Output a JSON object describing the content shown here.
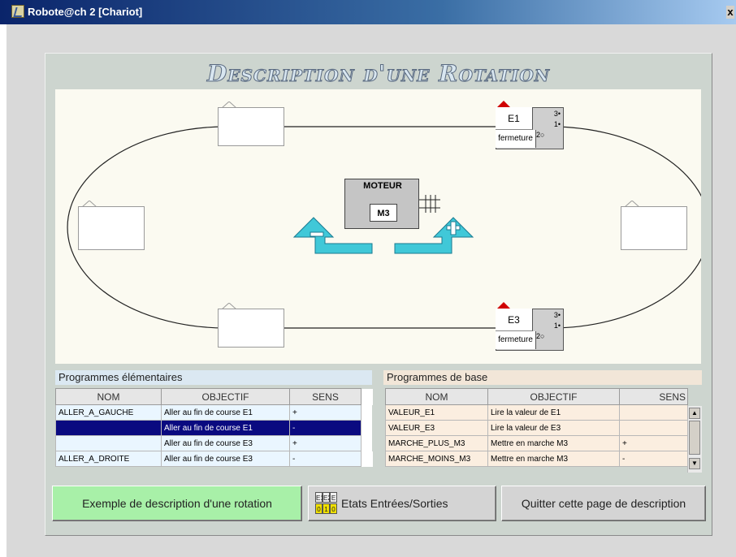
{
  "window": {
    "title": "Robote@ch 2 [Chariot]",
    "close_label": "x"
  },
  "page": {
    "heading": "Description d'une Rotation"
  },
  "diagram": {
    "motor": {
      "title": "MOTEUR",
      "label": "M3"
    },
    "sensors": [
      {
        "name": "E1",
        "label": "fermeture",
        "pins": [
          "3",
          "1",
          "2"
        ]
      },
      {
        "name": "E3",
        "label": "fermeture",
        "pins": [
          "3",
          "1",
          "2"
        ]
      }
    ],
    "colors": {
      "arrow": "#40c8d8",
      "marker": "#d00000"
    },
    "icons": [
      "rotate-minus-arrow-icon",
      "rotate-plus-arrow-icon",
      "motor-shaft-icon"
    ]
  },
  "elementary": {
    "header": "Programmes élémentaires",
    "columns": [
      "NOM",
      "OBJECTIF",
      "SENS"
    ],
    "rows": [
      {
        "nom": "ALLER_A_GAUCHE",
        "objectif": "Aller au fin de course E1",
        "sens": "+"
      },
      {
        "nom": "",
        "objectif": "Aller au fin de course E1",
        "sens": "-"
      },
      {
        "nom": "",
        "objectif": "Aller au fin de course E3",
        "sens": "+"
      },
      {
        "nom": "ALLER_A_DROITE",
        "objectif": "Aller au fin de course E3",
        "sens": "-"
      }
    ]
  },
  "base": {
    "header": "Programmes de base",
    "columns": [
      "NOM",
      "OBJECTIF",
      "SENS"
    ],
    "rows": [
      {
        "nom": "VALEUR_E1",
        "objectif": "Lire la valeur de E1",
        "sens": ""
      },
      {
        "nom": "VALEUR_E3",
        "objectif": "Lire la valeur de E3",
        "sens": ""
      },
      {
        "nom": "MARCHE_PLUS_M3",
        "objectif": "Mettre en marche M3",
        "sens": "+"
      },
      {
        "nom": "MARCHE_MOINS_M3",
        "objectif": "Mettre en marche M3",
        "sens": "-"
      }
    ]
  },
  "buttons": {
    "example": "Exemple de description d'une rotation",
    "io": "Etats Entrées/Sorties",
    "io_icon": {
      "top": [
        "E1",
        "E2",
        "E"
      ],
      "bottom": [
        "0",
        "1",
        "0"
      ]
    },
    "quit": "Quitter cette page de description"
  }
}
